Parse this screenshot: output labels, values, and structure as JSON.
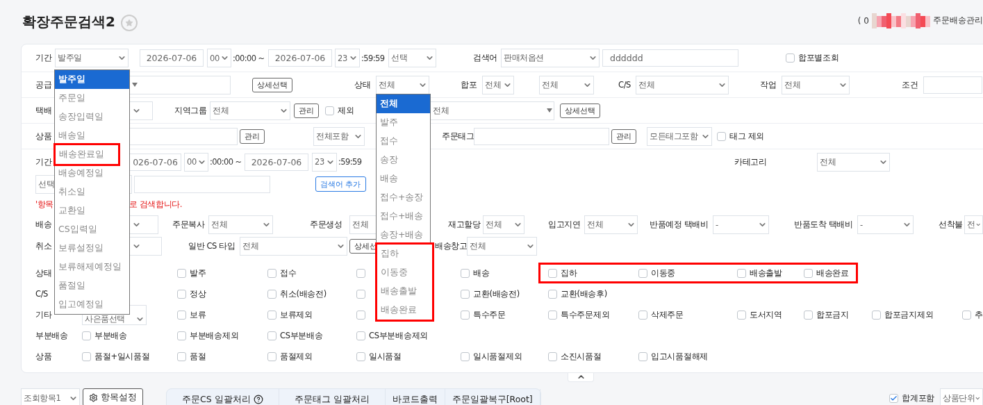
{
  "header": {
    "title": "확장주문검색2",
    "account_prefix": "( 0",
    "breadcrumb": "주문배송관리"
  },
  "form_rows": [
    {
      "items": [
        {
          "kind": "label",
          "text": "기간"
        },
        {
          "kind": "select",
          "value": "발주일"
        },
        {
          "kind": "date",
          "value": "2026-07-06"
        },
        {
          "kind": "select",
          "value": "00"
        },
        {
          "kind": "text",
          "text": ":00:00 ~"
        },
        {
          "kind": "date",
          "value": "2026-07-06"
        },
        {
          "kind": "select",
          "value": "23"
        },
        {
          "kind": "text",
          "text": ":59:59"
        },
        {
          "kind": "select",
          "value": "선택"
        },
        {
          "kind": "label",
          "text": "검색어"
        },
        {
          "kind": "select",
          "value": "판매처옵션"
        },
        {
          "kind": "input",
          "value": "dddddd"
        },
        {
          "kind": "checkbox",
          "label": "합포별조회",
          "checked": false
        }
      ]
    },
    {
      "items": [
        {
          "kind": "label",
          "text": "공급"
        },
        {
          "kind": "combo"
        },
        {
          "kind": "button",
          "text": "상세선택"
        },
        {
          "kind": "label",
          "text": "상태"
        },
        {
          "kind": "select",
          "value": "전체"
        },
        {
          "kind": "label",
          "text": "합포"
        },
        {
          "kind": "select",
          "value": "전체"
        },
        {
          "kind": "select",
          "value": "전체"
        },
        {
          "kind": "label",
          "text": "C/S"
        },
        {
          "kind": "select",
          "value": "전체"
        },
        {
          "kind": "label",
          "text": "작업"
        },
        {
          "kind": "select",
          "value": "전체"
        },
        {
          "kind": "label",
          "text": "조건"
        },
        {
          "kind": "input"
        }
      ]
    },
    {
      "items": [
        {
          "kind": "label",
          "text": "택배"
        },
        {
          "kind": "select"
        },
        {
          "kind": "label",
          "text": "지역그룹"
        },
        {
          "kind": "select",
          "value": "전체"
        },
        {
          "kind": "button",
          "text": "관리"
        },
        {
          "kind": "checkbox",
          "label": "제외",
          "checked": false
        },
        {
          "kind": "combo",
          "value": "전체"
        },
        {
          "kind": "button",
          "text": "상세선택"
        }
      ]
    },
    {
      "items": [
        {
          "kind": "label",
          "text": "상품"
        },
        {
          "kind": "input"
        },
        {
          "kind": "button",
          "text": "관리"
        },
        {
          "kind": "select",
          "value": "전체포함"
        },
        {
          "kind": "label",
          "text": "주문태그"
        },
        {
          "kind": "input"
        },
        {
          "kind": "button",
          "text": "관리"
        },
        {
          "kind": "select",
          "value": "모든태그포함"
        },
        {
          "kind": "checkbox",
          "label": "태그 제외",
          "checked": false
        }
      ]
    },
    {
      "items": [
        {
          "kind": "label",
          "text": "기간"
        },
        {
          "kind": "date",
          "value": "026-07-06"
        },
        {
          "kind": "select",
          "value": "00"
        },
        {
          "kind": "text",
          "text": ":00:00 ~"
        },
        {
          "kind": "date",
          "value": "2026-07-06"
        },
        {
          "kind": "select",
          "value": "23"
        },
        {
          "kind": "text",
          "text": ":59:59"
        },
        {
          "kind": "label",
          "text": "카테고리"
        },
        {
          "kind": "select",
          "value": "전체"
        }
      ]
    },
    {
      "items": [
        {
          "kind": "covered_select",
          "value": "선택"
        },
        {
          "kind": "input"
        },
        {
          "kind": "outline_button",
          "text": "검색어 추가"
        }
      ]
    },
    {
      "items": [
        {
          "kind": "note",
          "text": "'항목"
        },
        {
          "kind": "note",
          "text": "로 검색합니다."
        }
      ]
    },
    {
      "items": [
        {
          "kind": "label",
          "text": "배송"
        },
        {
          "kind": "select"
        },
        {
          "kind": "label",
          "text": "주문복사"
        },
        {
          "kind": "select",
          "value": "전체"
        },
        {
          "kind": "label",
          "text": "주문생성"
        },
        {
          "kind": "covered_select",
          "value": "전체"
        },
        {
          "kind": "label",
          "text": "재고할당"
        },
        {
          "kind": "select",
          "value": "전체"
        },
        {
          "kind": "label",
          "text": "입고지연"
        },
        {
          "kind": "select",
          "value": "전체"
        },
        {
          "kind": "label",
          "text": "반품예정 택배비"
        },
        {
          "kind": "select",
          "value": "-"
        },
        {
          "kind": "label",
          "text": "반품도착 택배비"
        },
        {
          "kind": "select",
          "value": "-"
        },
        {
          "kind": "label",
          "text": "선착불"
        },
        {
          "kind": "select",
          "value": "전"
        }
      ]
    },
    {
      "items": [
        {
          "kind": "label",
          "text": "취소"
        },
        {
          "kind": "select"
        },
        {
          "kind": "label",
          "text": "일반 CS 타입"
        },
        {
          "kind": "select",
          "value": "전체"
        },
        {
          "kind": "button",
          "text": "상세선"
        },
        {
          "kind": "label",
          "text": "배송창고"
        },
        {
          "kind": "select",
          "value": "전체"
        }
      ]
    }
  ],
  "checkbox_rows": [
    {
      "label": "상태",
      "options": [
        {
          "kind": "checkbox",
          "label": "발주",
          "checked": false,
          "highlighted": false
        },
        {
          "kind": "checkbox",
          "label": "접수",
          "checked": false,
          "highlighted": false
        },
        {
          "kind": "checkbox",
          "checked": false,
          "highlighted": false
        },
        {
          "kind": "checkbox",
          "label": "배송",
          "checked": false,
          "highlighted": false
        },
        {
          "kind": "checkbox",
          "label": "집하",
          "checked": false,
          "highlighted": true
        },
        {
          "kind": "checkbox",
          "label": "이동중",
          "checked": false,
          "highlighted": true
        },
        {
          "kind": "checkbox",
          "label": "배송출발",
          "checked": false,
          "highlighted": true
        },
        {
          "kind": "checkbox",
          "label": "배송완료",
          "checked": false,
          "highlighted": true
        }
      ]
    },
    {
      "label": "C/S",
      "options": [
        {
          "kind": "checkbox",
          "label": "정상",
          "checked": false
        },
        {
          "kind": "checkbox",
          "label": "취소(배송전)",
          "checked": false
        },
        {
          "kind": "checkbox",
          "checked": false
        },
        {
          "kind": "checkbox",
          "label": "교환(배송전)",
          "checked": false
        },
        {
          "kind": "checkbox",
          "label": "교환(배송후)",
          "checked": false
        }
      ]
    },
    {
      "label": "기타",
      "options": [
        {
          "kind": "select",
          "value": "사은품선택"
        },
        {
          "kind": "checkbox",
          "label": "보류",
          "checked": false
        },
        {
          "kind": "checkbox",
          "label": "보류제외",
          "checked": false
        },
        {
          "kind": "checkbox",
          "checked": false
        },
        {
          "kind": "checkbox",
          "label": "특수주문",
          "checked": false
        },
        {
          "kind": "checkbox",
          "label": "특수주문제외",
          "checked": false
        },
        {
          "kind": "checkbox",
          "label": "삭제주문",
          "checked": false
        },
        {
          "kind": "checkbox",
          "label": "도서지역",
          "checked": false
        },
        {
          "kind": "checkbox",
          "label": "합포금지",
          "checked": false
        },
        {
          "kind": "checkbox",
          "label": "합포금지제외",
          "checked": false
        },
        {
          "kind": "checkbox",
          "label": "추",
          "checked": false
        }
      ]
    },
    {
      "label": "부분배송",
      "options": [
        {
          "kind": "checkbox",
          "label": "부분배송",
          "checked": false
        },
        {
          "kind": "checkbox",
          "label": "부분배송제외",
          "checked": false
        },
        {
          "kind": "checkbox",
          "label": "CS부분배송",
          "checked": false
        },
        {
          "kind": "checkbox",
          "label": "CS부분배송제외",
          "checked": false
        }
      ]
    },
    {
      "label": "상품",
      "options": [
        {
          "kind": "checkbox",
          "label": "품절+일시품절",
          "checked": false
        },
        {
          "kind": "checkbox",
          "label": "품절",
          "checked": false
        },
        {
          "kind": "checkbox",
          "label": "품절제외",
          "checked": false
        },
        {
          "kind": "checkbox",
          "label": "일시품절",
          "checked": false
        },
        {
          "kind": "checkbox",
          "label": "일시품절제외",
          "checked": false
        },
        {
          "kind": "checkbox",
          "label": "소진시품절",
          "checked": false
        },
        {
          "kind": "checkbox",
          "label": "입고시품절해제",
          "checked": false
        }
      ]
    }
  ],
  "date_dropdown": {
    "items": [
      {
        "label": "발주일",
        "selected": true,
        "highlighted": false
      },
      {
        "label": "주문일",
        "selected": false,
        "highlighted": false
      },
      {
        "label": "송장입력일",
        "selected": false,
        "highlighted": false
      },
      {
        "label": "배송일",
        "selected": false,
        "highlighted": false
      },
      {
        "label": "배송완료일",
        "selected": false,
        "highlighted": true
      },
      {
        "label": "배송예정일",
        "selected": false,
        "highlighted": false
      },
      {
        "label": "취소일",
        "selected": false,
        "highlighted": false
      },
      {
        "label": "교환일",
        "selected": false,
        "highlighted": false
      },
      {
        "label": "CS입력일",
        "selected": false,
        "highlighted": false
      },
      {
        "label": "보류설정일",
        "selected": false,
        "highlighted": false
      },
      {
        "label": "보류해제예정일",
        "selected": false,
        "highlighted": false
      },
      {
        "label": "품절일",
        "selected": false,
        "highlighted": false
      },
      {
        "label": "입고예정일",
        "selected": false,
        "highlighted": false
      }
    ]
  },
  "status_dropdown": {
    "items": [
      {
        "label": "전체",
        "selected": true,
        "highlighted": false
      },
      {
        "label": "발주",
        "selected": false,
        "highlighted": false
      },
      {
        "label": "접수",
        "selected": false,
        "highlighted": false
      },
      {
        "label": "송장",
        "selected": false,
        "highlighted": false
      },
      {
        "label": "배송",
        "selected": false,
        "highlighted": false
      },
      {
        "label": "접수+송장",
        "selected": false,
        "highlighted": false
      },
      {
        "label": "접수+배송",
        "selected": false,
        "highlighted": false
      },
      {
        "label": "송장+배송",
        "selected": false,
        "highlighted": false
      },
      {
        "label": "집하",
        "selected": false,
        "highlighted": true
      },
      {
        "label": "이동중",
        "selected": false,
        "highlighted": true
      },
      {
        "label": "배송출발",
        "selected": false,
        "highlighted": true
      },
      {
        "label": "배송완료",
        "selected": false,
        "highlighted": true
      }
    ]
  },
  "bottom": {
    "view_select": "조회항목1",
    "settings_button": "항목설정",
    "tabs": [
      {
        "label": "주문CS 일괄처리",
        "help": true
      },
      {
        "label": "주문태그 일괄처리",
        "help": false
      },
      {
        "label": "바코드출력",
        "help": false
      },
      {
        "label": "주문일괄복구[Root]",
        "help": false
      }
    ],
    "total": {
      "label": "합계포함",
      "checked": true
    },
    "unit_select": "상품단위"
  }
}
